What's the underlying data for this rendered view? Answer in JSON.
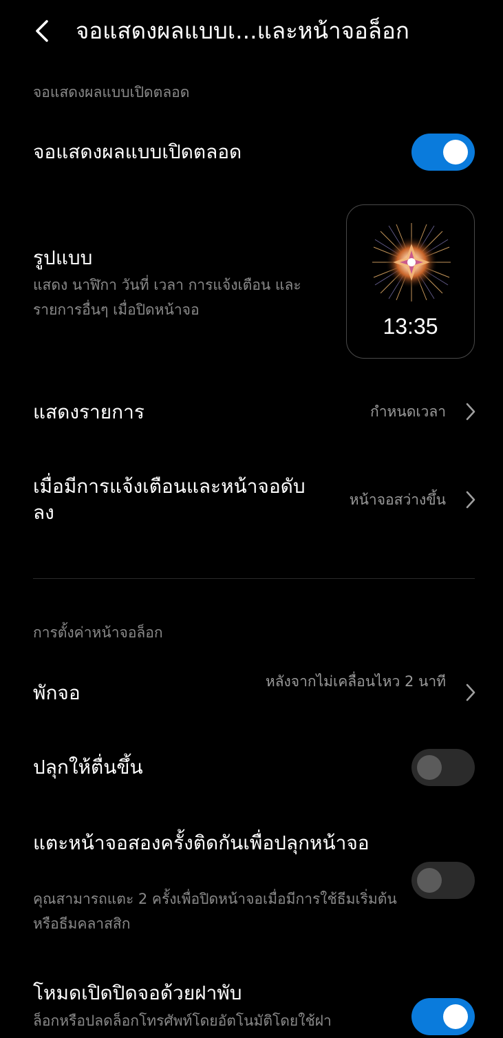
{
  "header": {
    "title": "จอแสดงผลแบบเ...และหน้าจอล็อก",
    "back_icon": "chevron-left-icon"
  },
  "aod_section": {
    "header": "จอแสดงผลแบบเปิดตลอด",
    "always_on": {
      "title": "จอแสดงผลแบบเปิดตลอด",
      "toggle_on": true
    },
    "style": {
      "title": "รูปแบบ",
      "subtitle": "แสดง นาฬิกา วันที่ เวลา การแจ้งเตือน และรายการอื่นๆ เมื่อปิดหน้าจอ",
      "preview_time": "13:35"
    },
    "show_items": {
      "title": "แสดงรายการ",
      "value": "กำหนดเวลา"
    },
    "notification": {
      "title": "เมื่อมีการแจ้งเตือนและหน้าจอดับลง",
      "value": "หน้าจอสว่างขึ้น"
    }
  },
  "lock_section": {
    "header": "การตั้งค่าหน้าจอล็อก",
    "sleep": {
      "title": "พักจอ",
      "value": "หลังจากไม่เคลื่อนไหว 2 นาที"
    },
    "wake_up": {
      "title": "ปลุกให้ตื่นขึ้น",
      "toggle_on": false
    },
    "double_tap": {
      "title": "แตะหน้าจอสองครั้งติดกันเพื่อปลุกหน้าจอ",
      "subtitle": "คุณสามารถแตะ 2 ครั้งเพื่อปิดหน้าจอเมื่อมีการใช้ธีมเริ่มต้นหรือธีมคลาสสิก",
      "toggle_on": false
    },
    "flip_cover": {
      "title": "โหมดเปิดปิดจอด้วยฝาพับ",
      "subtitle": "ล็อกหรือปลดล็อกโทรศัพท์โดยอัตโนมัติโดยใช้ฝา",
      "toggle_on": true
    }
  },
  "colors": {
    "accent": "#0a7bdc",
    "secondary_text": "#8a8a8a"
  }
}
